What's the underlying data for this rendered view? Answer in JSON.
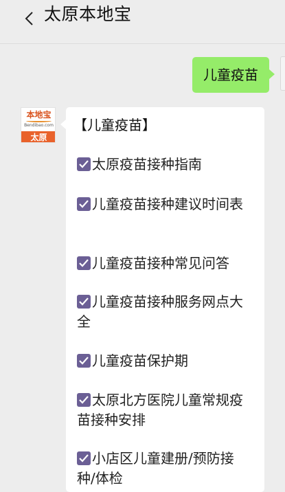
{
  "header": {
    "title": "太原本地宝"
  },
  "messages": {
    "outgoing_text": "儿童疫苗",
    "account_avatar": {
      "logo_text": "本地宝",
      "logo_url": "Bendibao.com",
      "city": "太原"
    },
    "reply_title": "【儿童疫苗】",
    "reply_items": [
      {
        "label": "太原疫苗接种指南"
      },
      {
        "label": "儿童疫苗接种建议时间表"
      },
      {
        "label": "儿童疫苗接种常见问答"
      },
      {
        "label": "儿童疫苗接种服务网点大全"
      },
      {
        "label": "儿童疫苗保护期"
      },
      {
        "label": "太原北方医院儿童常规疫苗接种安排"
      },
      {
        "label": "小店区儿童建册/预防接种/体检"
      }
    ]
  },
  "colors": {
    "outgoing_bubble": "#95ec69",
    "checkbox": "#6b5f95",
    "avatar_orange": "#e9622b"
  },
  "icons": [
    "chevron-left-icon",
    "checkbox-checked-icon"
  ]
}
